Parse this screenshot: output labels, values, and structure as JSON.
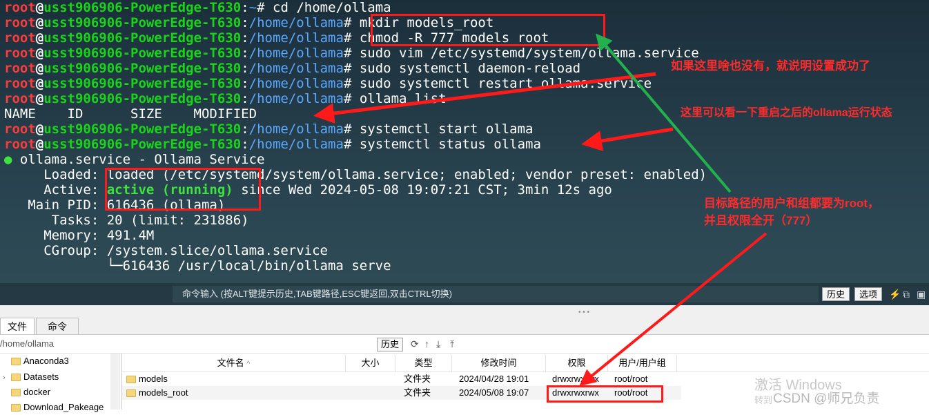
{
  "terminal": {
    "user": "root",
    "at": "@",
    "host": "usst906906-PowerEdge-T630",
    "colon": ":",
    "prompt_end": "# ",
    "path_home": "~",
    "path_ollama": "/home/ollama",
    "cmd1": "cd /home/ollama",
    "cmd2": "mkdir models_root",
    "cmd3": "chmod -R 777 models_root",
    "cmd4": "sudo vim /etc/systemd/system/ollama.service",
    "cmd5": "sudo systemctl daemon-reload",
    "cmd6": "sudo systemctl restart ollama.service",
    "cmd7": "ollama list",
    "list_header": "NAME    ID      SIZE    MODIFIED",
    "cmd8": "systemctl start ollama",
    "cmd9": "systemctl status ollama",
    "status_dot": "●",
    "status_title": " ollama.service - Ollama Service",
    "loaded": "     Loaded: loaded (/etc/systemd/system/ollama.service; enabled; vendor preset: enabled)",
    "active_label": "     Active: ",
    "active_state": "active (running)",
    "active_rest": " since Wed 2024-05-08 19:07:21 CST; 3min 12s ago",
    "mainpid": "   Main PID: 616436 (ollama)",
    "tasks": "      Tasks: 20 (limit: 231886)",
    "memory": "     Memory: 491.4M",
    "cgroup": "     CGroup: /system.slice/ollama.service",
    "cgroup_child": "             └─616436 /usr/local/bin/ollama serve"
  },
  "cmdbar": {
    "placeholder": "命令输入 (按ALT键提示历史,TAB键路径,ESC键返回,双击CTRL切换)",
    "history_btn": "历史",
    "options_btn": "选项",
    "icons": [
      "lightning-icon",
      "copy-icon",
      "clipboard-icon"
    ]
  },
  "tabs": {
    "files": "文件",
    "commands": "命令"
  },
  "pathbar": {
    "path": "/home/ollama",
    "history_btn": "历史",
    "icons": [
      "refresh-icon",
      "up-icon",
      "download-icon",
      "upload-icon"
    ]
  },
  "tree": {
    "items": [
      {
        "label": "Anaconda3",
        "expandable": false
      },
      {
        "label": "Datasets",
        "expandable": true
      },
      {
        "label": "docker",
        "expandable": false
      },
      {
        "label": "Download_Pakeage",
        "expandable": false
      }
    ]
  },
  "filelist": {
    "columns": [
      "文件名",
      "大小",
      "类型",
      "修改时间",
      "权限",
      "用户/用户组"
    ],
    "sort_indicator": "^",
    "rows": [
      {
        "name": "models",
        "size": "",
        "type": "文件夹",
        "modified": "2024/04/28 19:01",
        "perm": "drwxrwxrwx",
        "owner": "root/root"
      },
      {
        "name": "models_root",
        "size": "",
        "type": "文件夹",
        "modified": "2024/05/08 19:07",
        "perm": "drwxrwxrwx",
        "owner": "root/root"
      }
    ]
  },
  "annotations": {
    "note1": "如果这里啥也没有，就说明设置成功了",
    "note2": "这里可以看一下重启之后的ollama运行状态",
    "note3_line1": "目标路径的用户和组都要为root，",
    "note3_line2": "并且权限全开（777）"
  },
  "watermark": {
    "activate": "激活 Windows",
    "activate_sub": "转到",
    "csdn": "CSDN @师兄负责"
  },
  "colors": {
    "annotation_red": "#ff2b2b",
    "arrow_green": "#22b14c",
    "prompt_user": "#ff3b3b",
    "prompt_host": "#19d419",
    "prompt_path": "#5aa7ff"
  }
}
